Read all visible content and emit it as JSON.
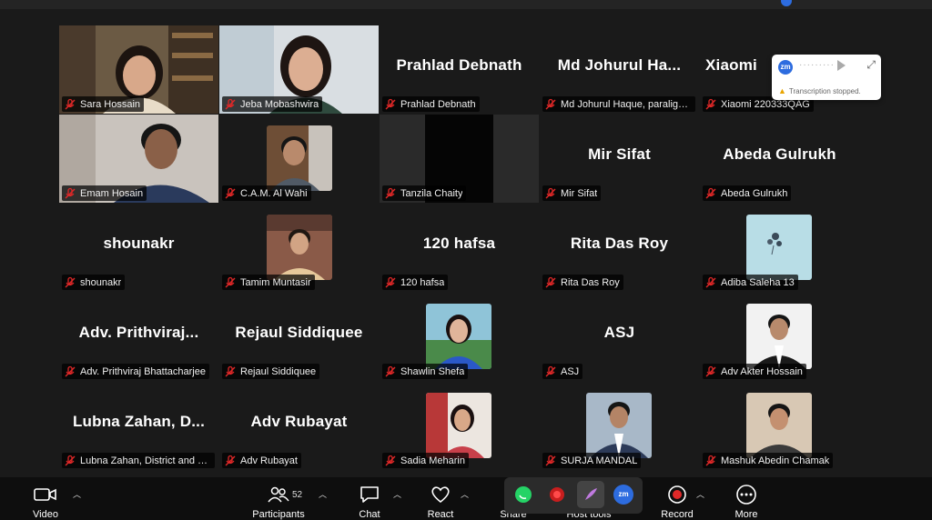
{
  "participants": [
    {
      "display_name": "",
      "label": "Sara Hossain",
      "video": true
    },
    {
      "display_name": "",
      "label": "Jeba Mobashwira",
      "video": true
    },
    {
      "display_name": "Prahlad Debnath",
      "label": "Prahlad Debnath",
      "video": false
    },
    {
      "display_name": "Md Johurul Ha...",
      "label": "Md Johurul Haque, paraligal...",
      "video": false
    },
    {
      "display_name": "Xiaomi",
      "label": "Xiaomi 220333QAG",
      "video": false
    },
    {
      "display_name": "",
      "label": "Emam Hosain",
      "video": true
    },
    {
      "display_name": "",
      "label": "C.A.M. Al Wahi",
      "video": true
    },
    {
      "display_name": "",
      "label": "Tanzila Chaity",
      "video": true
    },
    {
      "display_name": "Mir Sifat",
      "label": "Mir Sifat",
      "video": false
    },
    {
      "display_name": "Abeda Gulrukh",
      "label": "Abeda Gulrukh",
      "video": false
    },
    {
      "display_name": "shounakr",
      "label": "shounakr",
      "video": false
    },
    {
      "display_name": "",
      "label": "Tamim Muntasir",
      "video": true
    },
    {
      "display_name": "120 hafsa",
      "label": "120 hafsa",
      "video": false
    },
    {
      "display_name": "Rita Das Roy",
      "label": "Rita Das Roy",
      "video": false
    },
    {
      "display_name": "",
      "label": "Adiba Saleha 13",
      "video": true
    },
    {
      "display_name": "Adv.  Prithviraj...",
      "label": "Adv. Prithviraj Bhattacharjee",
      "video": false
    },
    {
      "display_name": "Rejaul Siddiquee",
      "label": "Rejaul Siddiquee",
      "video": false
    },
    {
      "display_name": "",
      "label": "Shawlin Shefa",
      "video": true
    },
    {
      "display_name": "ASJ",
      "label": "ASJ",
      "video": false
    },
    {
      "display_name": "",
      "label": "Adv Akter Hossain",
      "video": true
    },
    {
      "display_name": "Lubna  Zahan,  D...",
      "label": "Lubna Zahan, District and S...",
      "video": false
    },
    {
      "display_name": "Adv Rubayat",
      "label": "Adv Rubayat",
      "video": false
    },
    {
      "display_name": "",
      "label": "Sadia Meharin",
      "video": true
    },
    {
      "display_name": "",
      "label": "SURJA MANDAL",
      "video": true
    },
    {
      "display_name": "",
      "label": "Mashuk Abedin Chamak",
      "video": true
    }
  ],
  "transcription": {
    "logo_text": "zm",
    "dots": "·········",
    "message": "Transcription stopped."
  },
  "toolbar": {
    "video_label": "Video",
    "participants_label": "Participants",
    "participants_count": "52",
    "chat_label": "Chat",
    "react_label": "React",
    "share_label": "Share",
    "host_tools_label": "Host tools",
    "record_label": "Record",
    "more_label": "More",
    "zoom_app_text": "zm"
  },
  "colors": {
    "background": "#1a1a1a",
    "active_speaker": "#23d959",
    "muted_mic": "#e02828",
    "record": "#e02828",
    "zoom_blue": "#2d6cdf"
  }
}
